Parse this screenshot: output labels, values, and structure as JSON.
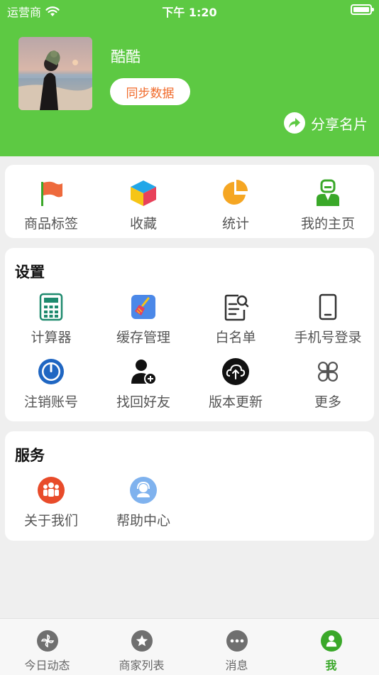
{
  "status_bar": {
    "carrier": "运营商",
    "time": "下午 1:20"
  },
  "profile": {
    "name": "酷酷",
    "sync_label": "同步数据",
    "share_label": "分享名片"
  },
  "quick_actions": [
    {
      "label": "商品标签",
      "icon": "flag-icon"
    },
    {
      "label": "收藏",
      "icon": "cube-icon"
    },
    {
      "label": "统计",
      "icon": "pie-chart-icon"
    },
    {
      "label": "我的主页",
      "icon": "user-home-icon"
    }
  ],
  "settings": {
    "title": "设置",
    "items": [
      {
        "label": "计算器",
        "icon": "calculator-icon"
      },
      {
        "label": "缓存管理",
        "icon": "broom-icon"
      },
      {
        "label": "白名单",
        "icon": "document-search-icon"
      },
      {
        "label": "手机号登录",
        "icon": "phone-icon"
      },
      {
        "label": "注销账号",
        "icon": "power-icon"
      },
      {
        "label": "找回好友",
        "icon": "add-person-icon"
      },
      {
        "label": "版本更新",
        "icon": "cloud-upload-icon"
      },
      {
        "label": "更多",
        "icon": "more-grid-icon"
      }
    ]
  },
  "services": {
    "title": "服务",
    "items": [
      {
        "label": "关于我们",
        "icon": "group-icon"
      },
      {
        "label": "帮助中心",
        "icon": "support-icon"
      }
    ]
  },
  "tabbar": [
    {
      "label": "今日动态",
      "icon": "pinwheel-icon",
      "active": false
    },
    {
      "label": "商家列表",
      "icon": "star-icon",
      "active": false
    },
    {
      "label": "消息",
      "icon": "chat-dots-icon",
      "active": false
    },
    {
      "label": "我",
      "icon": "person-icon",
      "active": true
    }
  ],
  "colors": {
    "header_green": "#5dc943",
    "accent_orange": "#f06a2a",
    "tab_active": "#3aa829"
  }
}
